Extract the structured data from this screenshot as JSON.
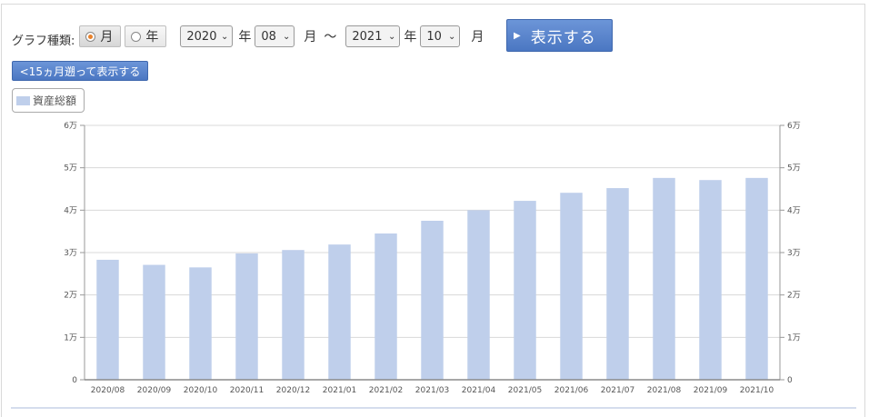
{
  "controls": {
    "graph_type_label": "グラフ種類:",
    "radio_month": "月",
    "radio_year": "年",
    "start_year": "2020",
    "start_month": "08",
    "end_year": "2021",
    "end_month": "10",
    "year_unit": "年",
    "month_unit": "月",
    "tilde": "〜",
    "show_button": "表示する",
    "back_button": "<15ヵ月遡って表示する"
  },
  "chart_data": {
    "type": "bar",
    "categories": [
      "2020/08",
      "2020/09",
      "2020/10",
      "2020/11",
      "2020/12",
      "2021/01",
      "2021/02",
      "2021/03",
      "2021/04",
      "2021/05",
      "2021/06",
      "2021/07",
      "2021/08",
      "2021/09",
      "2021/10"
    ],
    "series": [
      {
        "name": "資産総額",
        "color": "#bfcfeb",
        "values": [
          28300,
          27100,
          26500,
          29800,
          30600,
          31900,
          34500,
          37500,
          40000,
          42200,
          44100,
          45200,
          47600,
          47100,
          47600
        ]
      }
    ],
    "ylim": [
      0,
      60000
    ],
    "y_ticks": [
      {
        "value": 0,
        "label": "0"
      },
      {
        "value": 10000,
        "label": "1万"
      },
      {
        "value": 20000,
        "label": "2万"
      },
      {
        "value": 30000,
        "label": "3万"
      },
      {
        "value": 40000,
        "label": "4万"
      },
      {
        "value": 50000,
        "label": "5万"
      },
      {
        "value": 60000,
        "label": "6万"
      }
    ],
    "grid": true,
    "legend_position": "top-left",
    "dual_y_axis_labels": true
  }
}
